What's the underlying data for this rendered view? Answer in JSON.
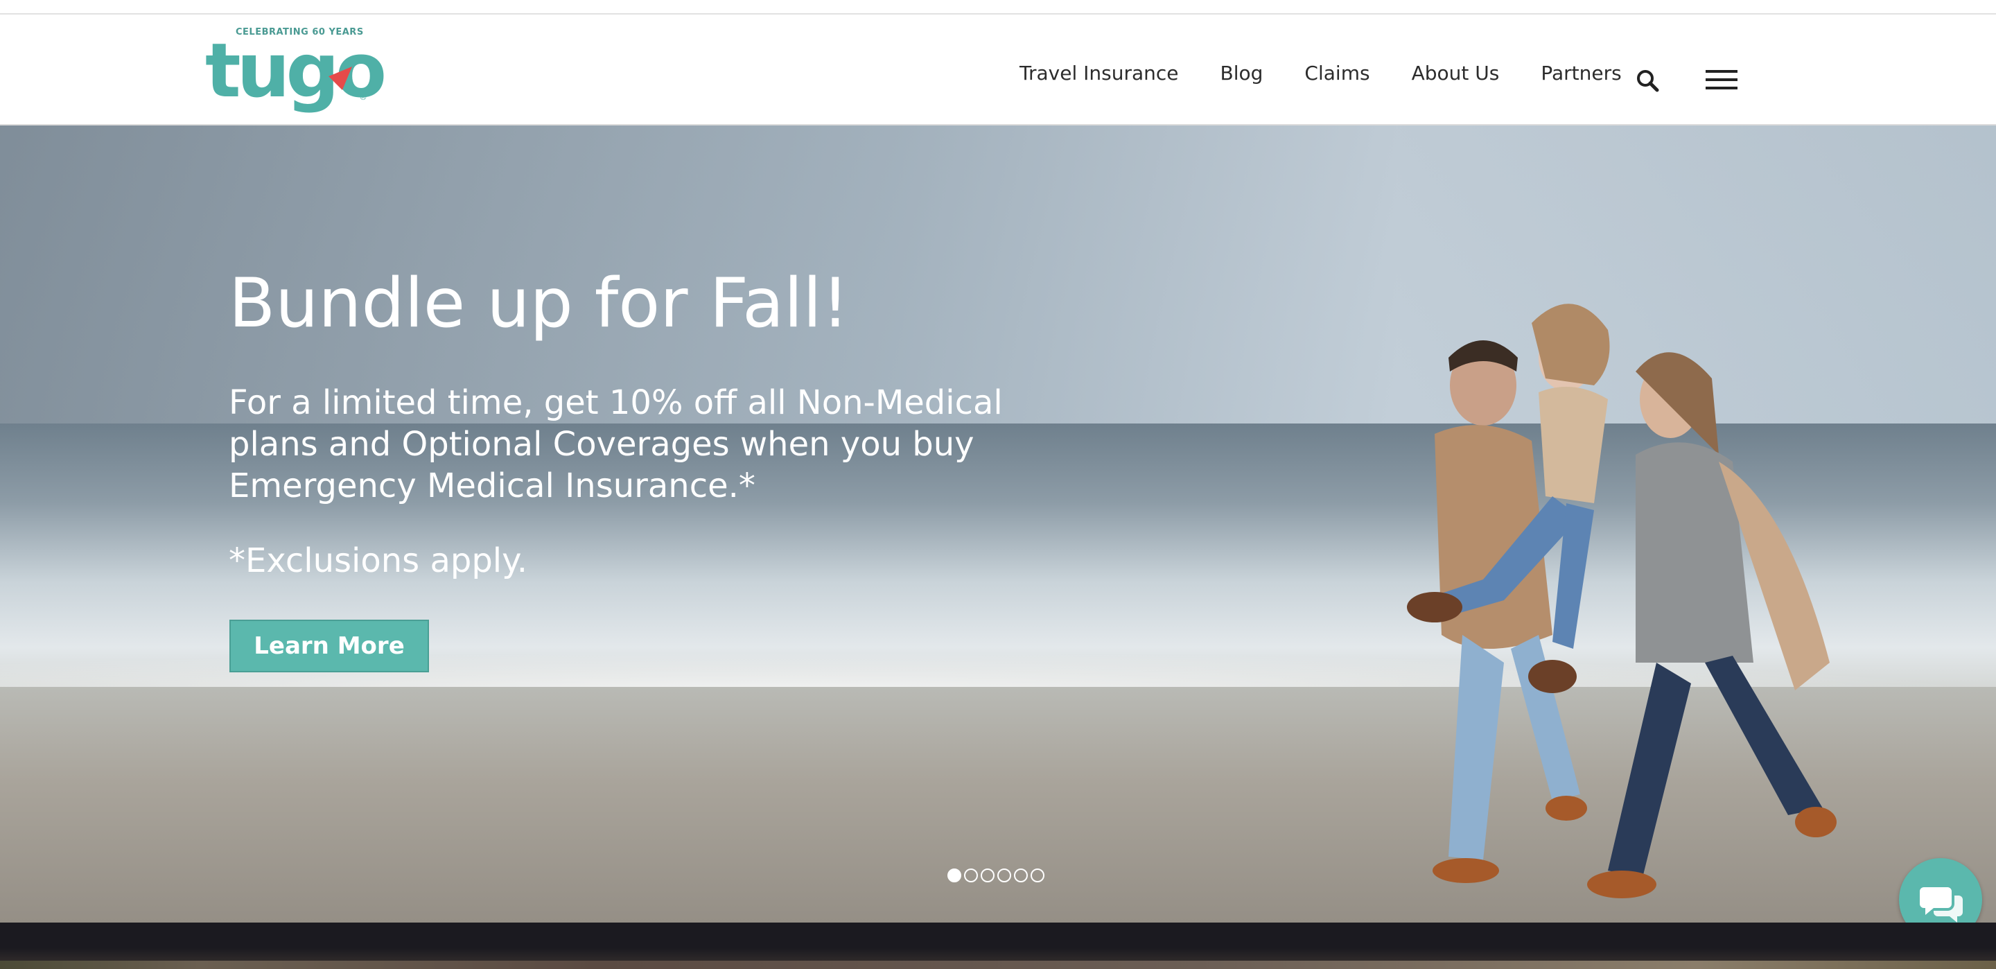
{
  "header": {
    "logo": {
      "tagline": "CELEBRATING 60 YEARS",
      "wordmark": "tugo",
      "registered": "®"
    },
    "nav": [
      "Travel Insurance",
      "Blog",
      "Claims",
      "About Us",
      "Partners"
    ],
    "search_icon": "search-icon",
    "menu_icon": "hamburger-menu-icon"
  },
  "hero": {
    "title": "Bundle up for Fall!",
    "body": "For a limited time, get 10% off all Non-Medical plans and Optional Coverages when you buy Emergency Medical Insurance.*",
    "note": "*Exclusions apply.",
    "cta": "Learn More",
    "slides": {
      "count": 6,
      "active": 1
    }
  },
  "chat": {
    "icon": "chat-icon"
  },
  "colors": {
    "brand_teal": "#5bb8ad",
    "logo_red": "#e54a4a",
    "dark_band": "#1b1a20"
  }
}
